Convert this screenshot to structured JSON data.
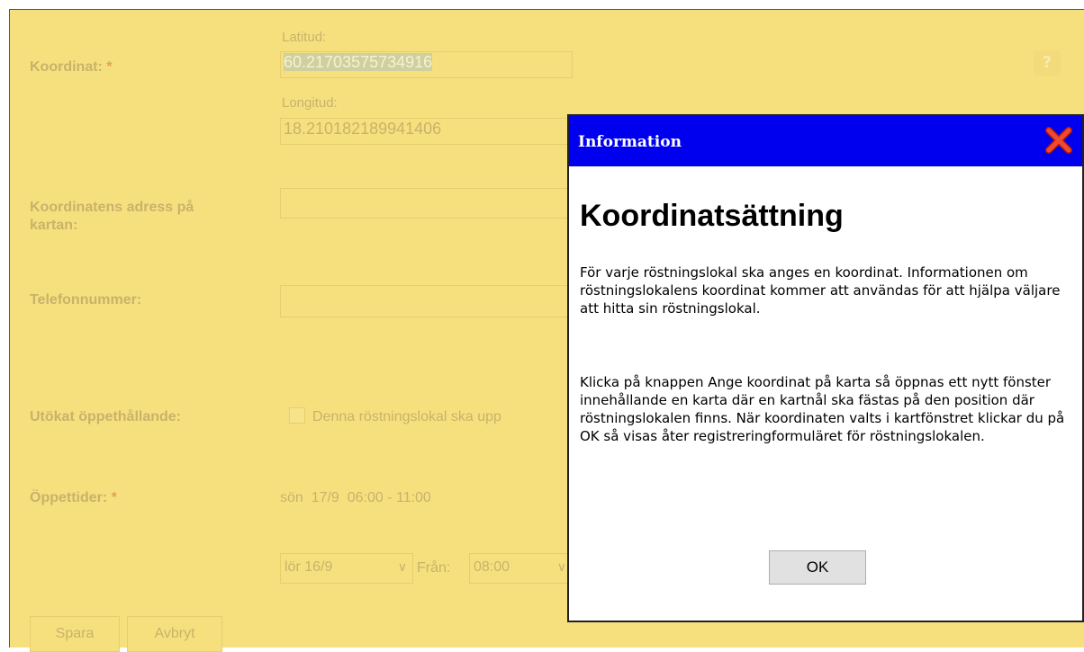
{
  "form": {
    "coordinate_label": "Koordinat:",
    "required_mark": "*",
    "latitude_label": "Latitud:",
    "latitude_value": "60.21703575734916",
    "longitude_label": "Longitud:",
    "longitude_value": "18.210182189941406",
    "address_label_line1": "Koordinatens adress på",
    "address_label_line2": "kartan:",
    "phone_label": "Telefonnummer:",
    "extended_hours_label": "Utökat öppethållande:",
    "extended_hours_checkbox_text": "Denna röstningslokal ska upp",
    "opening_hours_label": "Öppettider:",
    "opening_hours_entry": "sön  17/9  06:00 - 11:00",
    "day_select_value": "lör 16/9",
    "from_label": "Från:",
    "from_select_value": "08:00",
    "save_label": "Spara",
    "cancel_label": "Avbryt",
    "help_icon_glyph": "?"
  },
  "dialog": {
    "title": "Information",
    "heading": "Koordinatsättning",
    "paragraph1": "För varje röstningslokal ska anges en koordinat. Informationen om röstningslokalens koordinat kommer att användas för att hjälpa väljare att hitta sin röstningslokal.",
    "paragraph2": "Klicka på knappen Ange koordinat på karta så öppnas ett nytt fönster innehållande en karta där en kartnål ska fästas på den position där röstningslokalen finns. När koordinaten valts i kartfönstret klickar du på OK så visas åter registreringformuläret för röstningslokalen.",
    "ok_label": "OK"
  },
  "colors": {
    "form_background": "#f6e07e",
    "dialog_titlebar": "#0000ee",
    "close_icon": "#e8321e"
  }
}
